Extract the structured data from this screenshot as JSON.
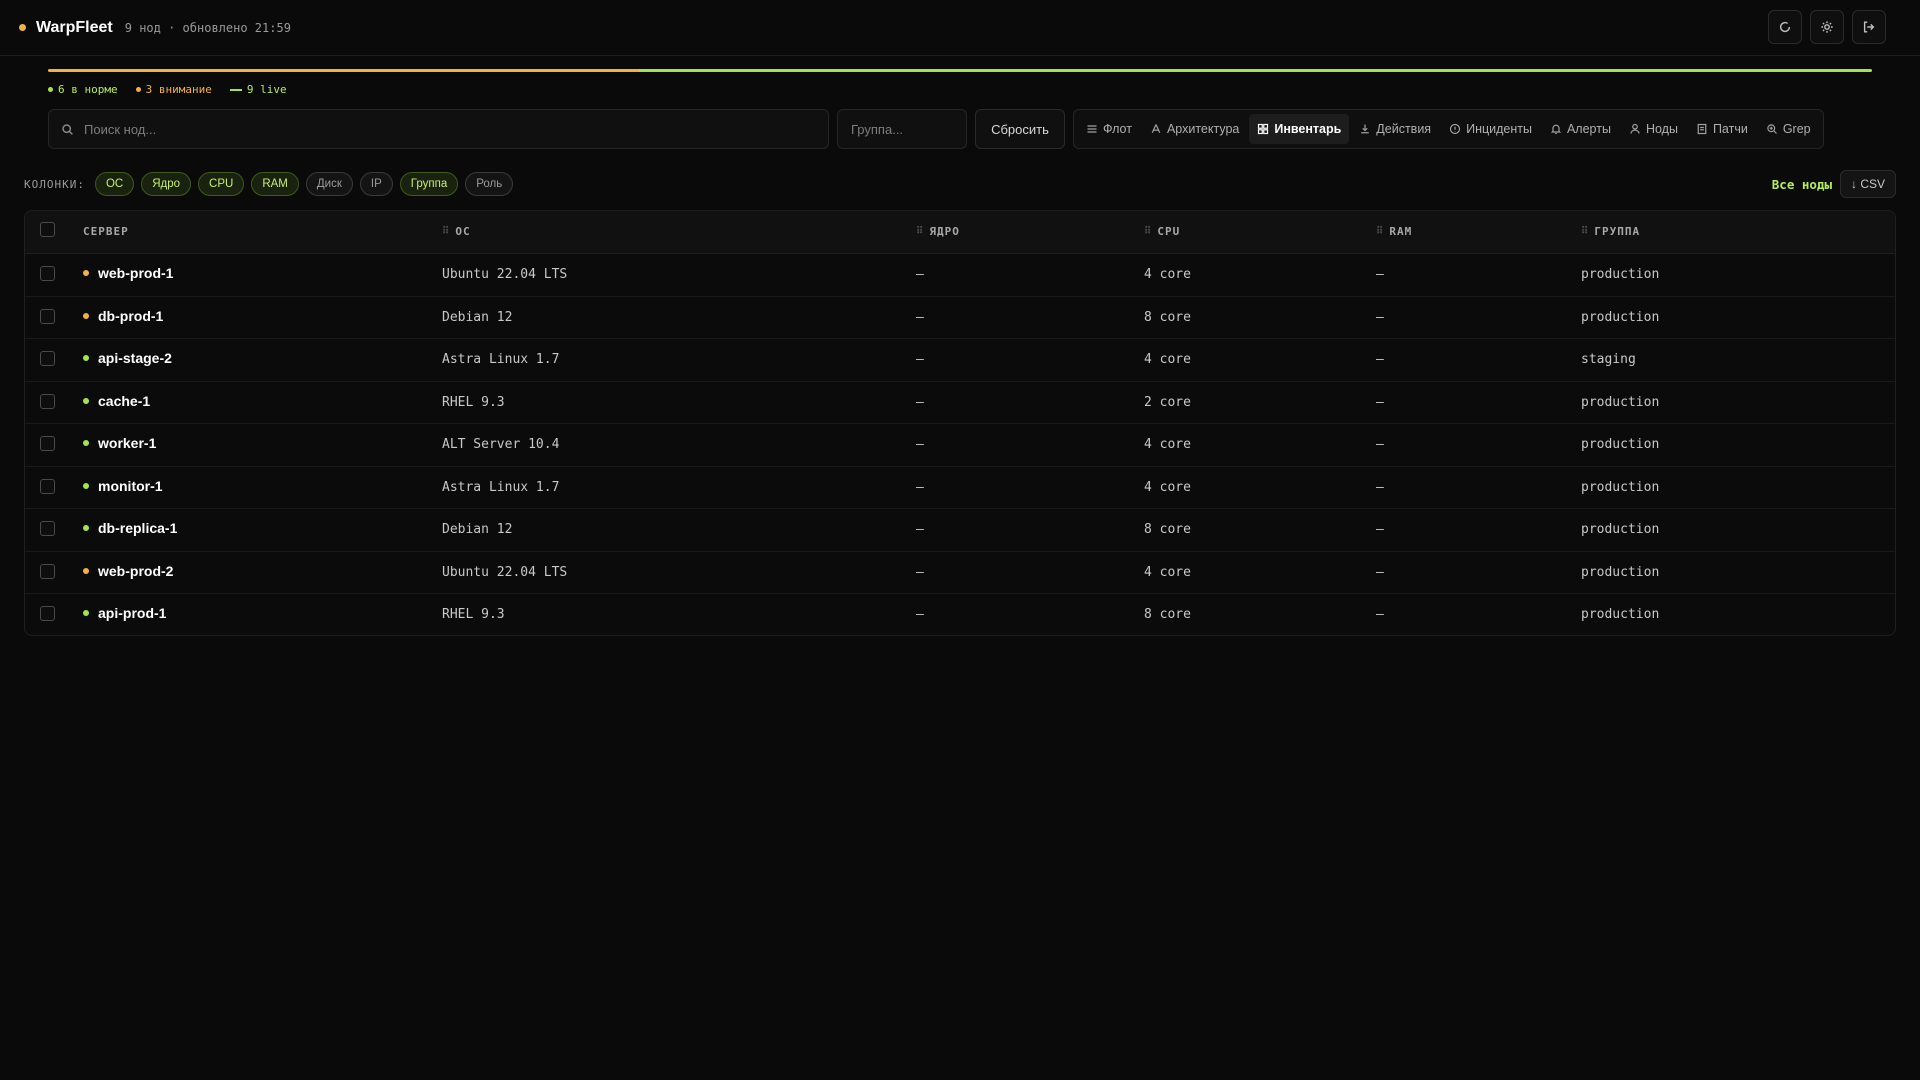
{
  "app": {
    "name": "WarpFleet",
    "meta": "9 нод · обновлено 21:59"
  },
  "health": {
    "warn_fraction": 0.324,
    "ok_fraction": 0.676,
    "warn_color": "#f3b13e",
    "ok_color": "#a6e34a"
  },
  "legend": {
    "ok": "6 в норме",
    "warn": "3 внимание",
    "live": "9 live"
  },
  "toolbar": {
    "search_placeholder": "Поиск нод...",
    "group_placeholder": "Группа...",
    "reset_label": "Сбросить"
  },
  "nav": [
    {
      "label": "Флот",
      "icon": "list-icon",
      "active": false
    },
    {
      "label": "Архитектура",
      "icon": "architecture-icon",
      "active": false
    },
    {
      "label": "Инвентарь",
      "icon": "grid-icon",
      "active": true
    },
    {
      "label": "Действия",
      "icon": "download-icon",
      "active": false
    },
    {
      "label": "Инциденты",
      "icon": "alert-circle-icon",
      "active": false
    },
    {
      "label": "Алерты",
      "icon": "bell-icon",
      "active": false
    },
    {
      "label": "Ноды",
      "icon": "user-icon",
      "active": false
    },
    {
      "label": "Патчи",
      "icon": "document-icon",
      "active": false
    },
    {
      "label": "Grep",
      "icon": "search-plus-icon",
      "active": false
    }
  ],
  "columns": {
    "label": "КОЛОНКИ:",
    "chips": [
      {
        "label": "ОС",
        "on": true
      },
      {
        "label": "Ядро",
        "on": true
      },
      {
        "label": "CPU",
        "on": true
      },
      {
        "label": "RAM",
        "on": true
      },
      {
        "label": "Диск",
        "on": false
      },
      {
        "label": "IP",
        "on": false
      },
      {
        "label": "Группа",
        "on": true
      },
      {
        "label": "Роль",
        "on": false
      }
    ]
  },
  "controls": {
    "all_nodes": "Все ноды",
    "csv": "↓ CSV"
  },
  "table": {
    "headers": {
      "server": "СЕРВЕР",
      "os": "ОС",
      "kernel": "ЯДРО",
      "cpu": "CPU",
      "ram": "RAM",
      "group": "ГРУППА"
    },
    "rows": [
      {
        "name": "web-prod-1",
        "status": "warn",
        "os": "Ubuntu 22.04 LTS",
        "kernel": "—",
        "cpu": "4 core",
        "ram": "—",
        "group": "production"
      },
      {
        "name": "db-prod-1",
        "status": "warn",
        "os": "Debian 12",
        "kernel": "—",
        "cpu": "8 core",
        "ram": "—",
        "group": "production"
      },
      {
        "name": "api-stage-2",
        "status": "ok",
        "os": "Astra Linux 1.7",
        "kernel": "—",
        "cpu": "4 core",
        "ram": "—",
        "group": "staging"
      },
      {
        "name": "cache-1",
        "status": "ok",
        "os": "RHEL 9.3",
        "kernel": "—",
        "cpu": "2 core",
        "ram": "—",
        "group": "production"
      },
      {
        "name": "worker-1",
        "status": "ok",
        "os": "ALT Server 10.4",
        "kernel": "—",
        "cpu": "4 core",
        "ram": "—",
        "group": "production"
      },
      {
        "name": "monitor-1",
        "status": "ok",
        "os": "Astra Linux 1.7",
        "kernel": "—",
        "cpu": "4 core",
        "ram": "—",
        "group": "production"
      },
      {
        "name": "db-replica-1",
        "status": "ok",
        "os": "Debian 12",
        "kernel": "—",
        "cpu": "8 core",
        "ram": "—",
        "group": "production"
      },
      {
        "name": "web-prod-2",
        "status": "warn",
        "os": "Ubuntu 22.04 LTS",
        "kernel": "—",
        "cpu": "4 core",
        "ram": "—",
        "group": "production"
      },
      {
        "name": "api-prod-1",
        "status": "ok",
        "os": "RHEL 9.3",
        "kernel": "—",
        "cpu": "8 core",
        "ram": "—",
        "group": "production"
      }
    ]
  }
}
